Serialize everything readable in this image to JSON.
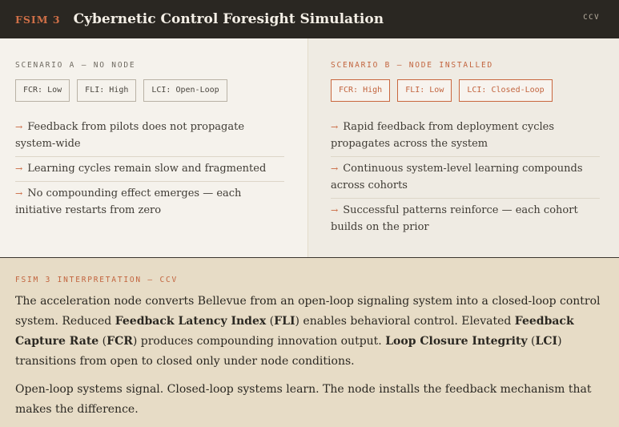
{
  "header": {
    "brand": "FSIM 3",
    "title": "Cybernetic Control Foresight Simulation",
    "tag": "CCV"
  },
  "scenario_a": {
    "label": "SCENARIO A — NO NODE",
    "tags": [
      "FCR: Low",
      "FLI: High",
      "LCI: Open-Loop"
    ],
    "items": [
      "Feedback from pilots does not propagate system-wide",
      "Learning cycles remain slow and fragmented",
      "No compounding effect emerges — each initiative restarts from zero"
    ]
  },
  "scenario_b": {
    "label": "SCENARIO B — NODE INSTALLED",
    "tags": [
      "FCR: High",
      "FLI: Low",
      "LCI: Closed-Loop"
    ],
    "items": [
      "Rapid feedback from deployment cycles propagates across the system",
      "Continuous system-level learning compounds across cohorts",
      "Successful patterns reinforce — each cohort builds on the prior"
    ]
  },
  "interpretation": {
    "label": "FSIM 3 INTERPRETATION — CCV",
    "p1": {
      "t1": "The acceleration node converts Bellevue from an open-loop signaling system into a closed-loop control system. Reduced ",
      "b1": "Feedback Latency Index",
      "t2": " (",
      "b2": "FLI",
      "t3": ") enables behavioral control. Elevated ",
      "b3": "Feedback Capture Rate",
      "t4": " (",
      "b4": "FCR",
      "t5": ") produces compounding innovation output. ",
      "b5": "Loop Closure Integrity",
      "t6": " (",
      "b6": "LCI",
      "t7": ") transitions from open to closed only under node conditions."
    },
    "p2": "Open-loop systems signal. Closed-loop systems learn. The node installs the feedback mechanism that makes the difference."
  },
  "colors": {
    "header_bg": "#2a2722",
    "accent": "#c9673f",
    "panel_a": "#f5f2ec",
    "panel_b": "#efebe3",
    "interp_bg": "#e7dcc6"
  }
}
